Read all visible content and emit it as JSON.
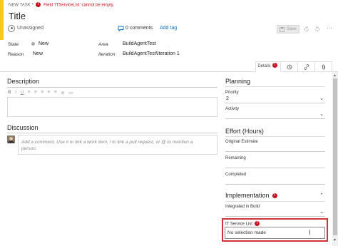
{
  "header": {
    "task_label": "NEW TASK *",
    "error_text": "Field 'ITServiceList' cannot be empty.",
    "title": "Title",
    "assignee": "Unassigned",
    "comments": "0 comments",
    "add_tag": "Add tag",
    "save_label": "Save"
  },
  "fields": {
    "state_label": "State",
    "state_value": "New",
    "reason_label": "Reason",
    "reason_value": "New",
    "area_label": "Area",
    "area_value": "BuildAgentTest",
    "iteration_label": "Iteration",
    "iteration_value": "BuildAgentTest\\Iteration 1"
  },
  "tabs": {
    "details": "Details"
  },
  "description": {
    "heading": "Description",
    "toolbar": [
      "B",
      "I",
      "U",
      "≡",
      "≡",
      "≡",
      "≡",
      "≡",
      "⊘",
      "▭"
    ]
  },
  "discussion": {
    "heading": "Discussion",
    "placeholder": "Add a comment. Use # to link a work item, ! to link a pull request, or @ to mention a person."
  },
  "planning": {
    "heading": "Planning",
    "priority_label": "Priority",
    "priority_value": "2",
    "activity_label": "Activity",
    "activity_value": ""
  },
  "effort": {
    "heading": "Effort (Hours)",
    "original_estimate_label": "Original Estimate",
    "remaining_label": "Remaining",
    "completed_label": "Completed"
  },
  "implementation": {
    "heading": "Implementation",
    "integrated_label": "Integrated in Build",
    "it_service_label": "IT Service List",
    "it_service_value": "No selection made"
  },
  "colors": {
    "accent": "#f2cb1d",
    "error": "#c50f1f",
    "link": "#106ebe",
    "highlight_border": "#d13438"
  }
}
